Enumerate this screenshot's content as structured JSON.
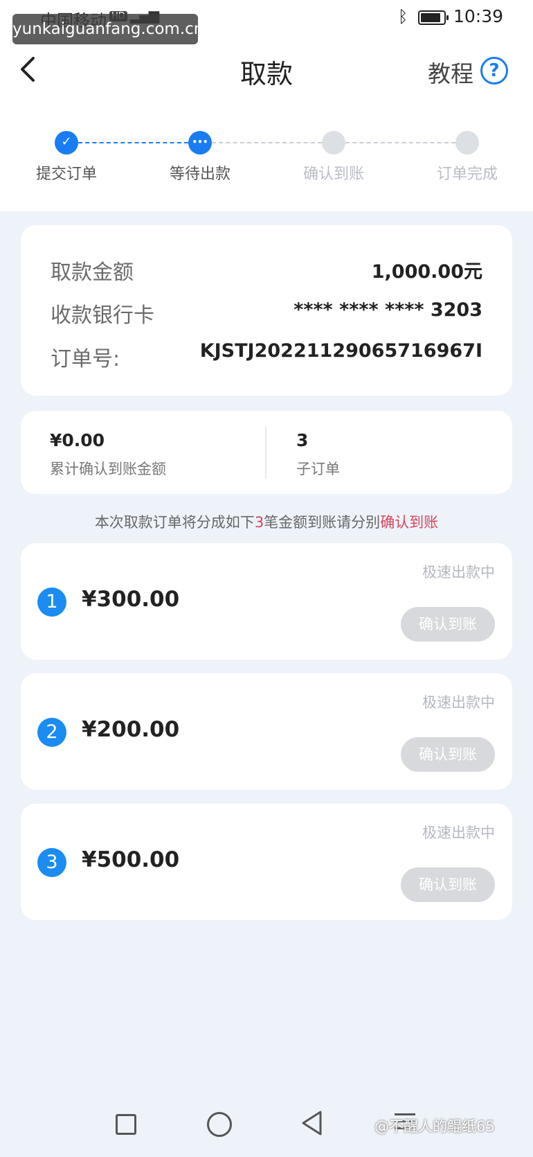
{
  "status_bar": {
    "carrier": "中国移动",
    "hd_badge": "HD",
    "signal_icon": "signal-icon",
    "bluetooth_icon": "bluetooth-icon",
    "battery_icon": "battery-icon",
    "time": "10:39"
  },
  "watermark_top": "yunkaiguanfang.com.cn",
  "header": {
    "back_icon": "chevron-left-icon",
    "title": "取款",
    "tutorial_label": "教程",
    "help_icon": "question-circle-icon",
    "help_glyph": "?"
  },
  "steps": [
    {
      "label": "提交订单",
      "state": "done",
      "glyph": "✓"
    },
    {
      "label": "等待出款",
      "state": "current",
      "glyph": "•••"
    },
    {
      "label": "确认到账",
      "state": "pending",
      "glyph": ""
    },
    {
      "label": "订单完成",
      "state": "pending",
      "glyph": ""
    }
  ],
  "withdraw_info": {
    "amount_label": "取款金额",
    "amount_value": "1,000.00元",
    "card_label": "收款银行卡",
    "card_value": "**** **** **** 3203",
    "order_label": "订单号:",
    "order_value": "KJSTJ20221129065716967I"
  },
  "summary": {
    "confirmed_amount": "¥0.00",
    "confirmed_label": "累计确认到账金额",
    "sub_order_count": "3",
    "sub_order_label": "子订单"
  },
  "notice": {
    "prefix": "本次取款订单将分成如下",
    "count": "3",
    "middle": "笔金额到账请分别",
    "action": "确认到账"
  },
  "sub_orders": [
    {
      "index": "1",
      "amount": "¥300.00",
      "status": "极速出款中",
      "button": "确认到账"
    },
    {
      "index": "2",
      "amount": "¥200.00",
      "status": "极速出款中",
      "button": "确认到账"
    },
    {
      "index": "3",
      "amount": "¥500.00",
      "status": "极速出款中",
      "button": "确认到账"
    }
  ],
  "nav_bar": {
    "recents_icon": "square-icon",
    "home_icon": "circle-icon",
    "back_icon": "triangle-back-icon",
    "menu_icon": "menu-icon"
  },
  "watermark_bottom": "@不醒人的鲲纸65",
  "colors": {
    "accent": "#1a7cf2",
    "highlight": "#d9435a",
    "background": "#eef3fa",
    "button_disabled": "#d7d9dc"
  }
}
